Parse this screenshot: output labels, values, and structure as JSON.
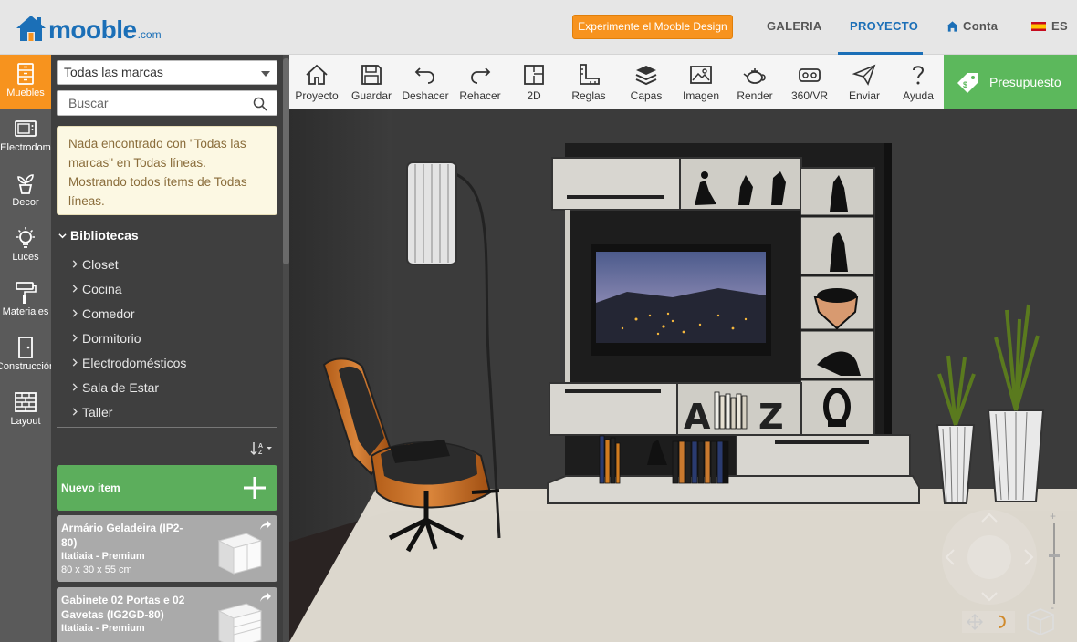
{
  "header": {
    "brand": "mooble",
    "brand_tld": ".com",
    "promo_label": "Experimente el Mooble Design",
    "nav": {
      "galeria": "GALERIA",
      "proyecto": "PROYECTO",
      "conta": "Conta",
      "lang": "ES"
    }
  },
  "categories": [
    {
      "label": "Muebles",
      "active": true
    },
    {
      "label": "Electrodom"
    },
    {
      "label": "Decor"
    },
    {
      "label": "Luces"
    },
    {
      "label": "Materiales"
    },
    {
      "label": "Construcción"
    },
    {
      "label": "Layout"
    }
  ],
  "library": {
    "brand_select": "Todas las marcas",
    "search_placeholder": "Buscar",
    "notice": "Nada encontrado con \"Todas las marcas\" en Todas líneas. Mostrando todos ítems de Todas líneas.",
    "section_title": "Bibliotecas",
    "items": [
      "Closet",
      "Cocina",
      "Comedor",
      "Dormitorio",
      "Electrodomésticos",
      "Sala de Estar",
      "Taller"
    ],
    "new_item_label": "Nuevo item",
    "products": [
      {
        "name": "Armário Geladeira (IP2-80)",
        "brand": "Itatiaia - Premium",
        "dims": "80 x 30 x 55 cm"
      },
      {
        "name": "Gabinete 02 Portas e 02 Gavetas (IG2GD-80)",
        "brand": "Itatiaia - Premium",
        "dims": ""
      }
    ]
  },
  "toolbar": {
    "proyecto": "Proyecto",
    "guardar": "Guardar",
    "deshacer": "Deshacer",
    "rehacer": "Rehacer",
    "view2d": "2D",
    "reglas": "Reglas",
    "capas": "Capas",
    "imagen": "Imagen",
    "render": "Render",
    "vr": "360/VR",
    "enviar": "Enviar",
    "ayuda": "Ayuda",
    "budget": "Presupuesto"
  },
  "scene": {
    "letters": [
      "A",
      "Z"
    ]
  },
  "colors": {
    "brand_blue": "#1b6fb7",
    "accent_orange": "#f7931e",
    "green": "#5cb85c",
    "sidebar_dark": "#5a5a5a",
    "panel_dark": "#3f3f3f"
  }
}
